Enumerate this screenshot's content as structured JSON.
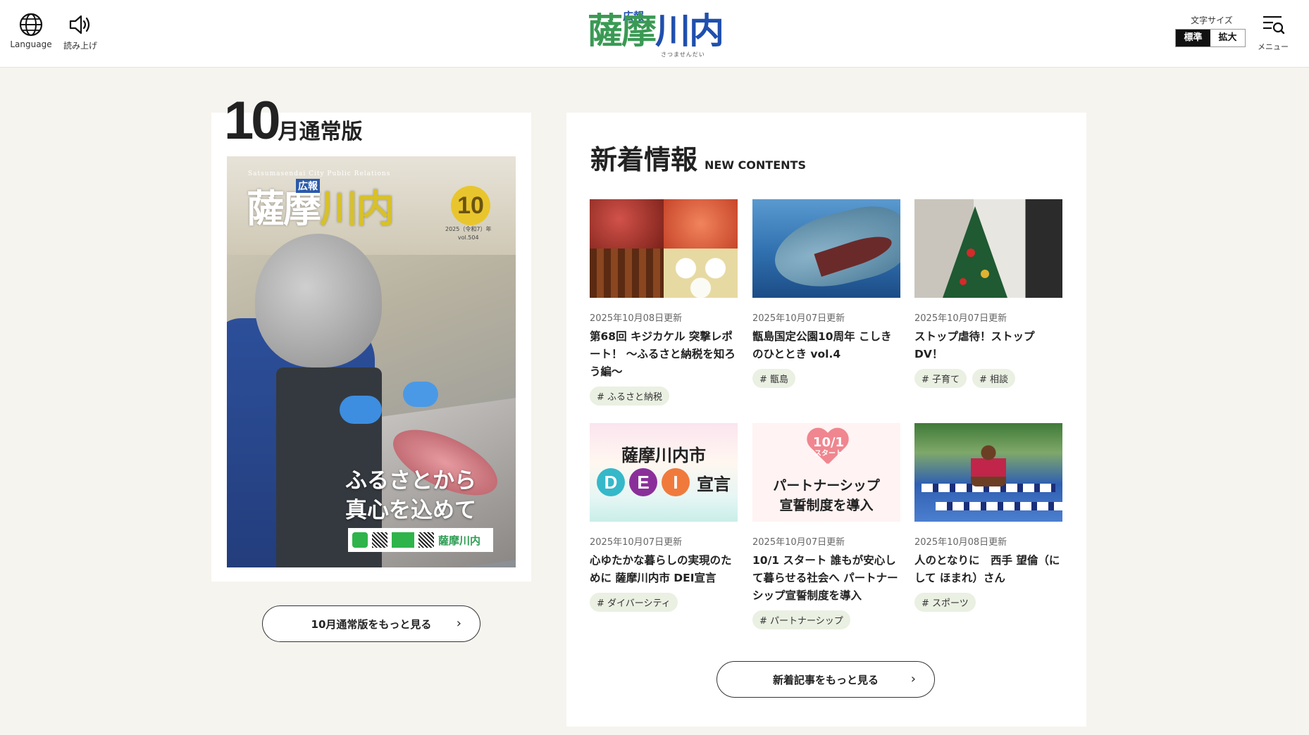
{
  "header": {
    "language_label": "Language",
    "read_aloud_label": "読み上げ",
    "logo": {
      "small": "広報",
      "main_part1": "薩摩",
      "main_part2": "川内",
      "kana": "さつませんだい"
    },
    "font_size": {
      "caption": "文字サイズ",
      "standard": "標準",
      "large": "拡大",
      "selected": "標準"
    },
    "menu_label": "メニュー"
  },
  "issue": {
    "month_number": "10",
    "title_suffix": "月通常版",
    "cover": {
      "english": "Satsumasendai City Public Relations",
      "koho": "広報",
      "logo_main": "薩摩",
      "logo_yellow": "川内",
      "number": "10",
      "meta_line1": "2025（令和7）年",
      "meta_line2": "vol.504",
      "catch_line1": "ふるさとから",
      "catch_line2": "真心を込めて",
      "footer_logo": "薩摩川内"
    },
    "more_button": "10月通常版をもっと見る"
  },
  "news": {
    "heading_jp": "新着情報",
    "heading_en": "NEW CONTENTS",
    "items": [
      {
        "date": "2025年10月08日更新",
        "title": "第68回 キジカケル 突撃レポート！ ～ふるさと納税を知ろう編～",
        "tags": [
          "# ふるさと納税"
        ]
      },
      {
        "date": "2025年10月07日更新",
        "title": "甑島国定公園10周年 こしきのひととき vol.4",
        "tags": [
          "# 甑島"
        ]
      },
      {
        "date": "2025年10月07日更新",
        "title": "ストップ虐待！ストップDV！",
        "tags": [
          "# 子育て",
          "# 相談"
        ]
      },
      {
        "date": "2025年10月07日更新",
        "title": "心ゆたかな暮らしの実現のために 薩摩川内市 DEI宣言",
        "tags": [
          "# ダイバーシティ"
        ],
        "thumb_text": {
          "line1": "薩摩川内市",
          "d": "D",
          "e": "E",
          "i": "I",
          "sengen": "宣言"
        }
      },
      {
        "date": "2025年10月07日更新",
        "title": "10/1 スタート 誰もが安心して暮らせる社会へ パートナーシップ宣誓制度を導入",
        "tags": [
          "# パートナーシップ"
        ],
        "thumb_text": {
          "date": "10/1",
          "start": "スタート",
          "line1": "パートナーシップ",
          "line2": "宣誓制度を導入"
        }
      },
      {
        "date": "2025年10月08日更新",
        "title": "人のとなりに　西手 望倫（にして ほまれ）さん",
        "tags": [
          "# スポーツ"
        ]
      }
    ],
    "more_button": "新着記事をもっと見る"
  },
  "colors": {
    "page_bg": "#f6f4ee",
    "logo_green": "#3a9a54",
    "logo_blue": "#1f4fae",
    "tag_bg": "#eaf0e2",
    "dei_d": "#35b8c9",
    "dei_e": "#8a2f9a",
    "dei_i": "#f07a3c"
  },
  "icons": {
    "language": "globe-icon",
    "read_aloud": "speaker-icon",
    "menu": "menu-search-icon",
    "more_arrow": "chevron-right-icon"
  }
}
